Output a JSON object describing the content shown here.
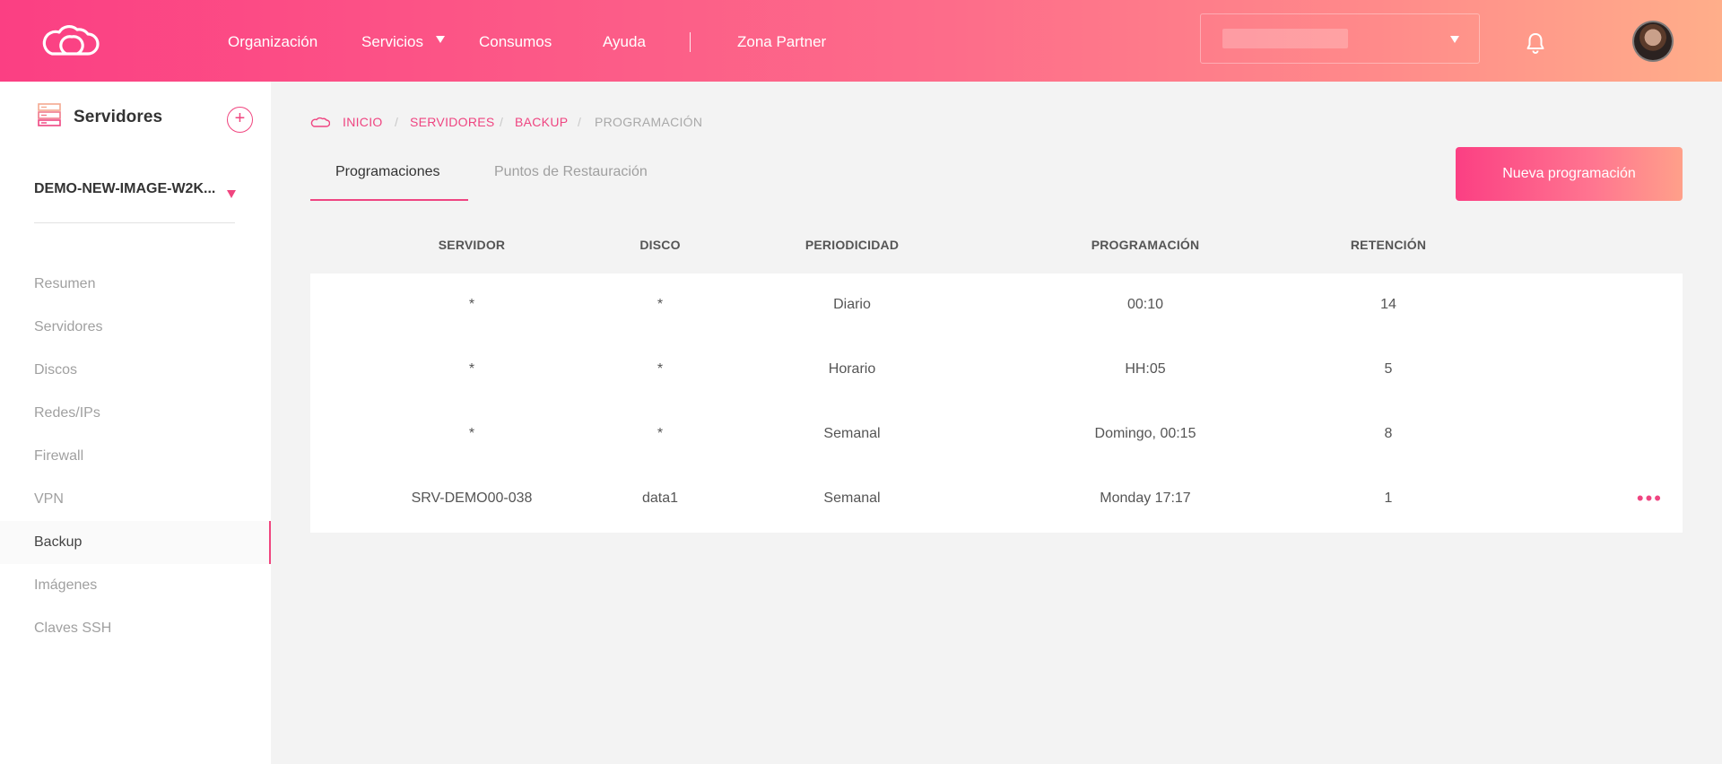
{
  "header": {
    "nav": [
      "Organización",
      "Servicios",
      "Consumos",
      "Ayuda",
      "Zona Partner"
    ]
  },
  "sidebar": {
    "title": "Servidores",
    "add_label": "+",
    "selected_server": "DEMO-NEW-IMAGE-W2K...",
    "items": [
      "Resumen",
      "Servidores",
      "Discos",
      "Redes/IPs",
      "Firewall",
      "VPN",
      "Backup",
      "Imágenes",
      "Claves SSH"
    ],
    "active_item": "Backup"
  },
  "breadcrumb": [
    "INICIO",
    "SERVIDORES",
    "BACKUP",
    "PROGRAMACIÓN"
  ],
  "tabs": [
    "Programaciones",
    "Puntos de Restauración"
  ],
  "new_button": "Nueva programación",
  "table": {
    "columns": [
      "SERVIDOR",
      "DISCO",
      "PERIODICIDAD",
      "PROGRAMACIÓN",
      "RETENCIÓN"
    ],
    "rows": [
      [
        "*",
        "*",
        "Diario",
        "00:10",
        "14"
      ],
      [
        "*",
        "*",
        "Horario",
        "HH:05",
        "5"
      ],
      [
        "*",
        "*",
        "Semanal",
        "Domingo, 00:15",
        "8"
      ],
      [
        "SRV-DEMO00-038",
        "data1",
        "Semanal",
        "Monday 17:17",
        "1"
      ]
    ],
    "row_menu": "•••"
  },
  "colors": {
    "accent": "#ef4581",
    "header_gradient_start": "#fb3f83",
    "header_gradient_end": "#ffae8a"
  }
}
